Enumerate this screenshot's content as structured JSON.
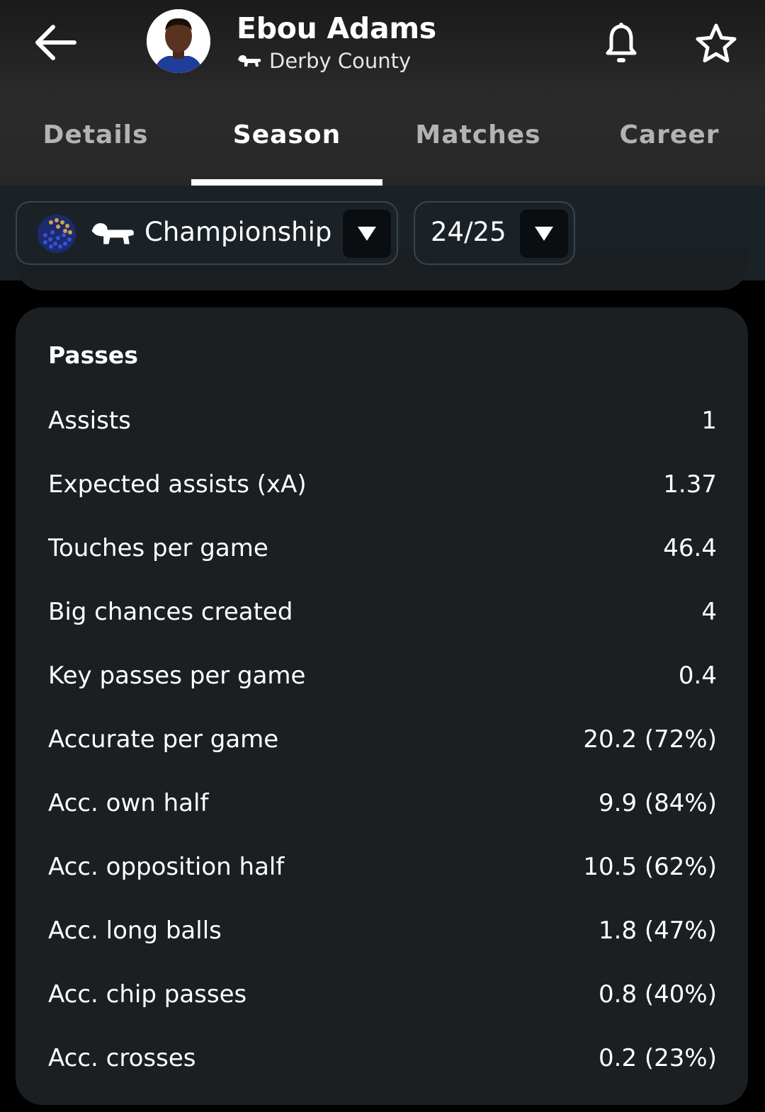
{
  "header": {
    "player_name": "Ebou Adams",
    "team_name": "Derby County",
    "icons": {
      "back": "back-arrow-icon",
      "bell": "bell-icon",
      "star": "star-icon",
      "team_crest": "derby-ram-icon"
    }
  },
  "tabs": [
    {
      "label": "Details",
      "active": false
    },
    {
      "label": "Season",
      "active": true
    },
    {
      "label": "Matches",
      "active": false
    },
    {
      "label": "Career",
      "active": false
    }
  ],
  "filters": {
    "competition": {
      "label": "Championship",
      "icons": [
        "championship-logo-icon",
        "derby-ram-icon"
      ]
    },
    "season": {
      "label": "24/25"
    }
  },
  "passes": {
    "title": "Passes",
    "rows": [
      {
        "label": "Assists",
        "value": "1"
      },
      {
        "label": "Expected assists (xA)",
        "value": "1.37"
      },
      {
        "label": "Touches per game",
        "value": "46.4"
      },
      {
        "label": "Big chances created",
        "value": "4"
      },
      {
        "label": "Key passes per game",
        "value": "0.4"
      },
      {
        "label": "Accurate per game",
        "value": "20.2 (72%)"
      },
      {
        "label": "Acc. own half",
        "value": "9.9 (84%)"
      },
      {
        "label": "Acc. opposition half",
        "value": "10.5 (62%)"
      },
      {
        "label": "Acc. long balls",
        "value": "1.8 (47%)"
      },
      {
        "label": "Acc. chip passes",
        "value": "0.8 (40%)"
      },
      {
        "label": "Acc. crosses",
        "value": "0.2 (23%)"
      }
    ]
  },
  "colors": {
    "background": "#000000",
    "card": "#1b1f22",
    "filter_bar": "#1b2227",
    "text_primary": "#ffffff",
    "text_inactive_tab": "#b3b3b3"
  }
}
